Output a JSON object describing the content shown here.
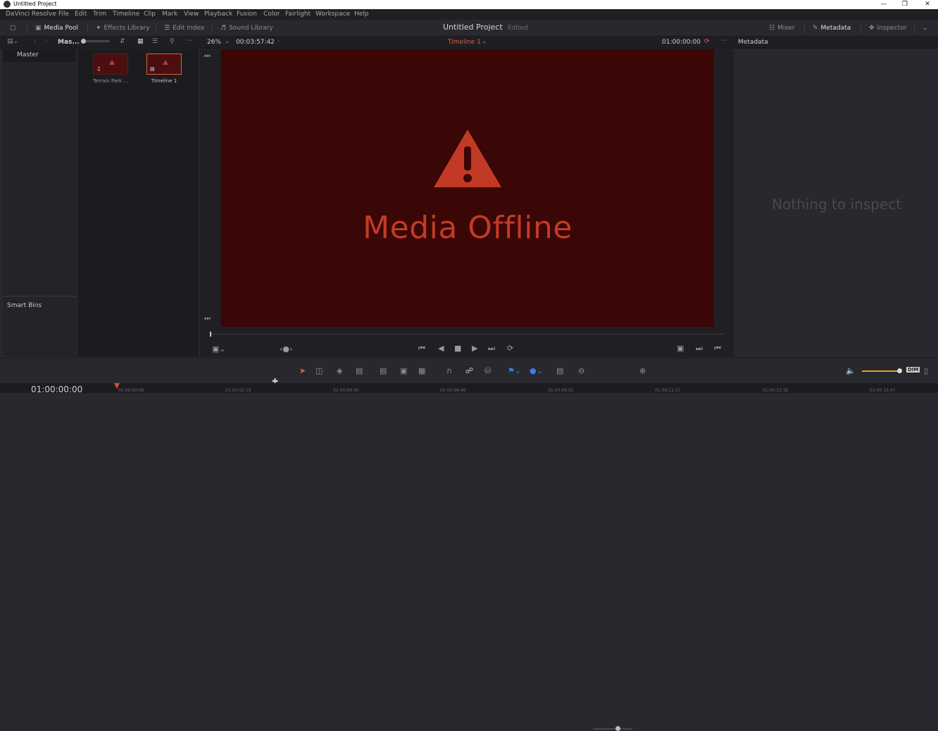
{
  "window": {
    "title": "Untitled Project"
  },
  "menu": [
    "DaVinci Resolve",
    "File",
    "Edit",
    "Trim",
    "Timeline",
    "Clip",
    "Mark",
    "View",
    "Playback",
    "Fusion",
    "Color",
    "Fairlight",
    "Workspace",
    "Help"
  ],
  "toolbar": {
    "media_pool": "Media Pool",
    "effects_library": "Effects Library",
    "edit_index": "Edit Index",
    "sound_library": "Sound Library",
    "project_title": "Untitled Project",
    "project_status": "Edited",
    "mixer": "Mixer",
    "metadata": "Metadata",
    "inspector": "Inspector"
  },
  "subbar": {
    "bin_name": "Mas...",
    "zoom": "26%",
    "duration": "00:03:57:42",
    "timeline_name": "Timeline 1",
    "timecode": "01:00:00:00",
    "panel_title": "Metadata"
  },
  "bins": {
    "master": "Master",
    "smart_bins": "Smart Bins"
  },
  "clips": [
    {
      "name": "Terrain Park ...",
      "kind": "audio"
    },
    {
      "name": "Timeline 1",
      "kind": "timeline"
    }
  ],
  "viewer": {
    "message": "Media Offline"
  },
  "inspector": {
    "empty_text": "Nothing to inspect"
  },
  "audio": {
    "dim": "DIM"
  },
  "timeline": {
    "timecode": "01:00:00:00",
    "ticks": [
      "01:00:00:00",
      "01:00:02:15",
      "01:00:04:30",
      "01:00:06:46",
      "01:00:09:01",
      "01:00:11:17",
      "01:00:13:32",
      "01:00:15:47"
    ]
  },
  "colors": {
    "offline_bg": "#3a0606",
    "offline_text": "#c23a26",
    "playhead": "#e04a3a",
    "timeline_name": "#e06040"
  }
}
